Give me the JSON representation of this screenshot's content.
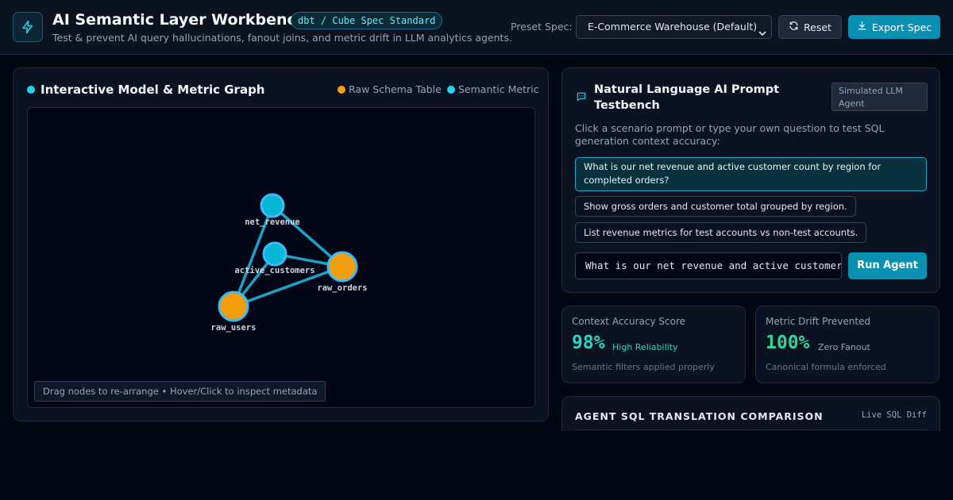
{
  "header": {
    "title": "AI Semantic Layer Workbench",
    "badge": "dbt / Cube Spec Standard",
    "subtitle": "Test & prevent AI query hallucinations, fanout joins, and metric drift in LLM analytics agents.",
    "preset_label": "Preset Spec:",
    "preset_value": "E-Commerce Warehouse (Default)",
    "reset_label": "Reset",
    "export_label": "Export Spec",
    "logo_icon": "lightning-icon"
  },
  "graph": {
    "title": "Interactive Model & Metric Graph",
    "legend": [
      {
        "label": "Raw Schema Table",
        "color": "#f59e0b"
      },
      {
        "label": "Semantic Metric",
        "color": "#22d3ee"
      }
    ],
    "nodes": [
      {
        "id": "net_revenue",
        "label": "net_revenue",
        "kind": "metric"
      },
      {
        "id": "active_customers",
        "label": "active_customers",
        "kind": "metric"
      },
      {
        "id": "raw_orders",
        "label": "raw_orders",
        "kind": "table"
      },
      {
        "id": "raw_users",
        "label": "raw_users",
        "kind": "table"
      }
    ],
    "edges": [
      [
        "net_revenue",
        "raw_orders"
      ],
      [
        "net_revenue",
        "raw_users"
      ],
      [
        "active_customers",
        "raw_orders"
      ],
      [
        "active_customers",
        "raw_users"
      ],
      [
        "raw_users",
        "raw_orders"
      ]
    ],
    "hint": "Drag nodes to re-arrange • Hover/Click to inspect metadata",
    "colors": {
      "metric": "#06b6d4",
      "table": "#f59e0b",
      "edge": "#22b3d6",
      "ring": "#38bdf8"
    }
  },
  "prompt": {
    "title": "Natural Language AI Prompt Testbench",
    "badge": "Simulated LLM Agent",
    "description": "Click a scenario prompt or type your own question to test SQL generation context accuracy:",
    "scenarios": [
      "What is our net revenue and active customer count by region for completed orders?",
      "Show gross orders and customer total grouped by region.",
      "List revenue metrics for test accounts vs non-test accounts."
    ],
    "input_value": "What is our net revenue and active customer count by region for completed orders?",
    "run_label": "Run Agent"
  },
  "stats": [
    {
      "label": "Context Accuracy Score",
      "value": "98%",
      "tag": "High Reliability",
      "sub": "Semantic filters applied properly",
      "color": "#2dd4bf"
    },
    {
      "label": "Metric Drift Prevented",
      "value": "100%",
      "tag": "Zero Fanout",
      "sub": "Canonical formula enforced",
      "color": "#34d399"
    }
  ],
  "sql": {
    "title": "AGENT SQL TRANSLATION COMPARISON",
    "tag": "Live SQL Diff"
  }
}
